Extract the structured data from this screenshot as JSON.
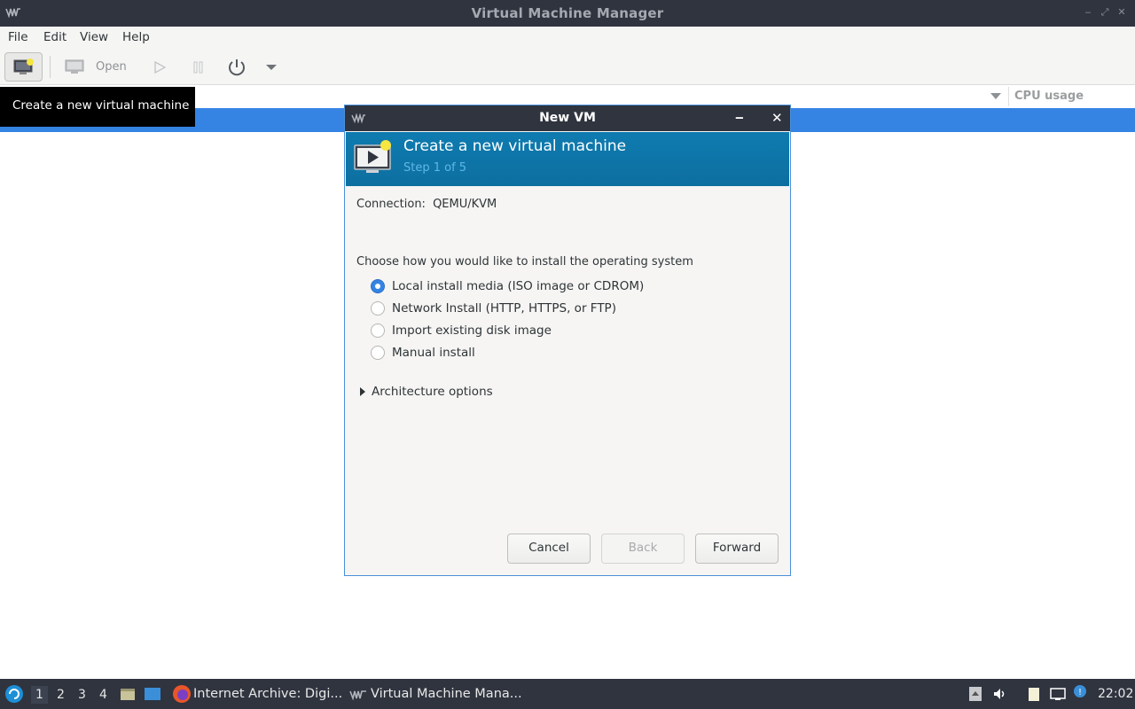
{
  "window": {
    "title": "Virtual Machine Manager"
  },
  "menu": {
    "file": "File",
    "edit": "Edit",
    "view": "View",
    "help": "Help"
  },
  "toolbar": {
    "open_label": "Open"
  },
  "tooltip": {
    "text": "Create a new virtual machine"
  },
  "list": {
    "cpu_usage_header": "CPU usage"
  },
  "dialog": {
    "title": "New VM",
    "banner_title": "Create a new virtual machine",
    "banner_step": "Step 1 of 5",
    "connection_label": "Connection:",
    "connection_value": "QEMU/KVM",
    "choose_label": "Choose how you would like to install the operating system",
    "options": [
      {
        "label": "Local install media (ISO image or CDROM)",
        "selected": true
      },
      {
        "label": "Network Install (HTTP, HTTPS, or FTP)",
        "selected": false
      },
      {
        "label": "Import existing disk image",
        "selected": false
      },
      {
        "label": "Manual install",
        "selected": false
      }
    ],
    "architecture_label": "Architecture options",
    "buttons": {
      "cancel": "Cancel",
      "back": "Back",
      "forward": "Forward"
    }
  },
  "taskbar": {
    "workspaces": [
      "1",
      "2",
      "3",
      "4"
    ],
    "active_workspace": "1",
    "tasks": [
      {
        "label": "Internet Archive: Digi...",
        "icon": "firefox-icon"
      },
      {
        "label": "Virtual Machine Mana...",
        "icon": "virt-manager-icon"
      }
    ],
    "clock": "22:02"
  },
  "colors": {
    "titlebar": "#2f343f",
    "selection": "#3584e4",
    "banner": "#0e76a8",
    "dialog_border": "#4a90d9"
  }
}
